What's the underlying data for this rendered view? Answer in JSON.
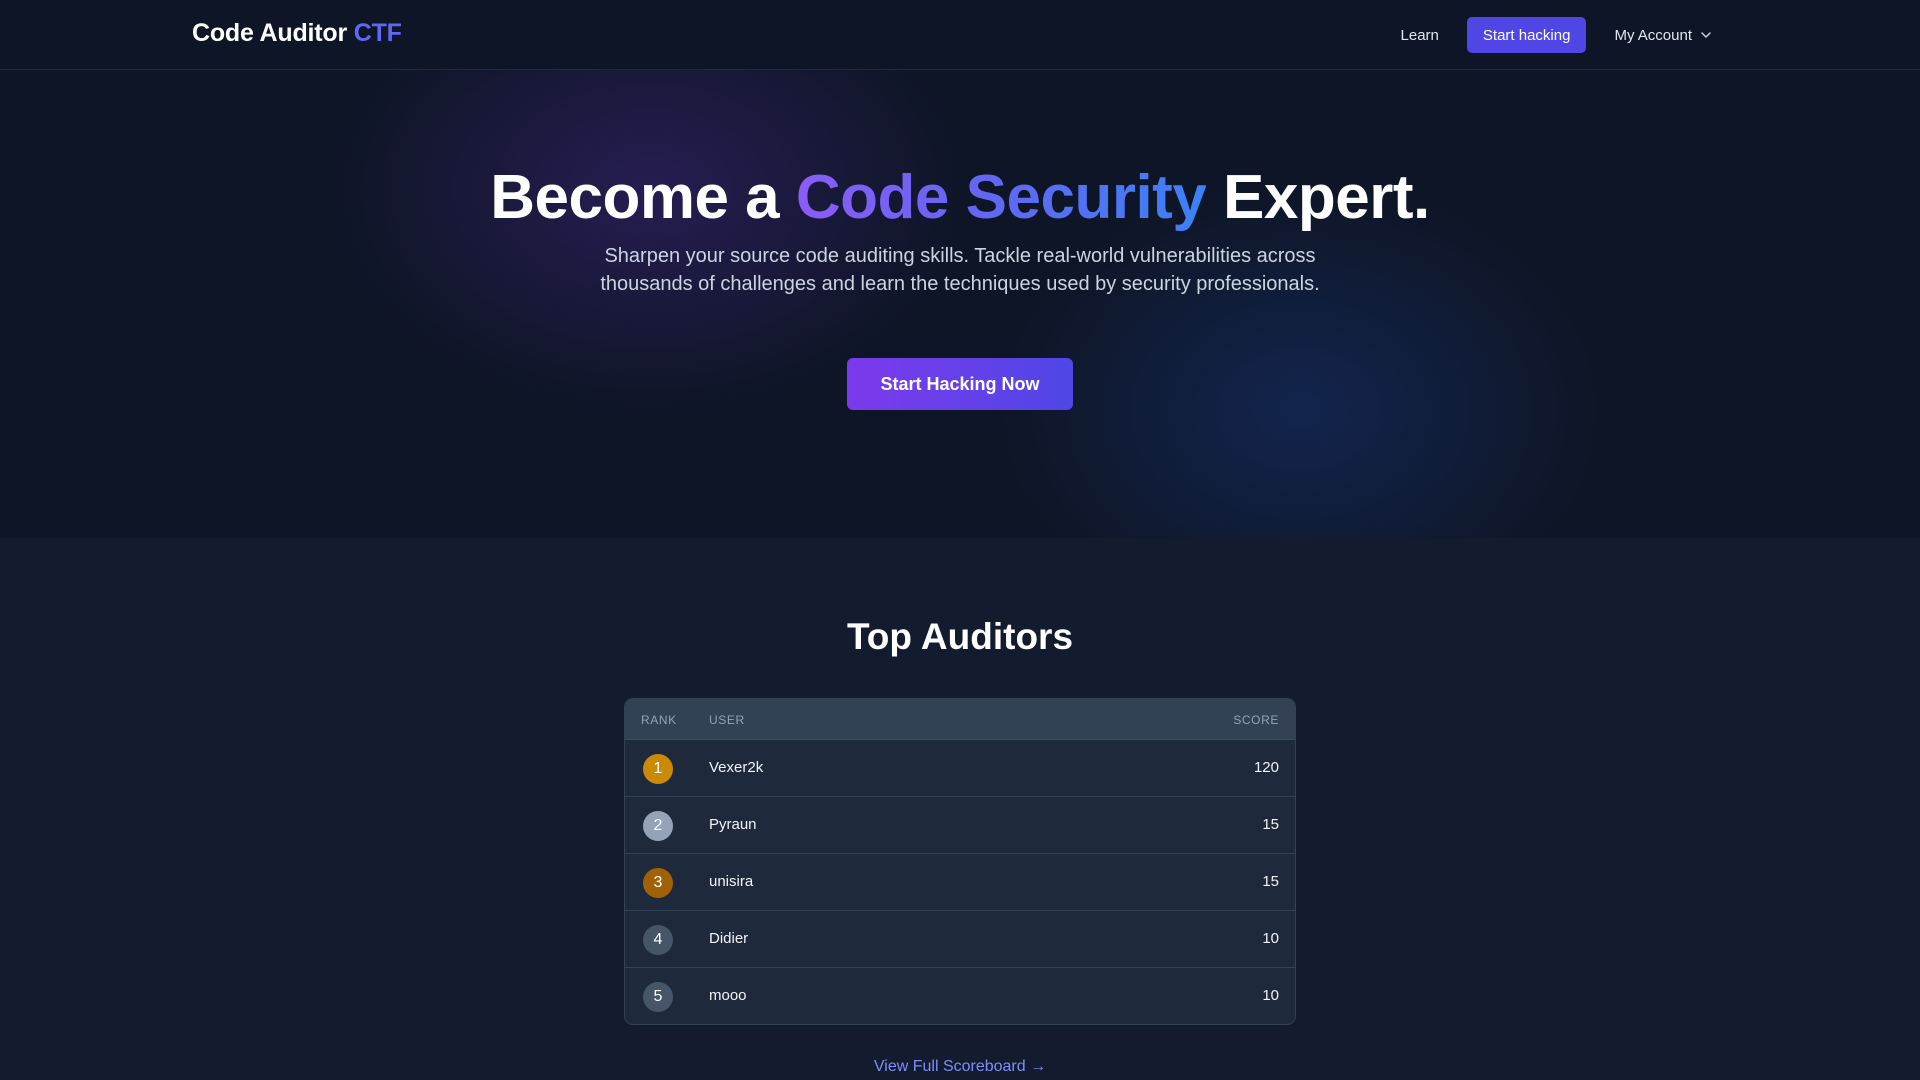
{
  "nav": {
    "logo_main": "Code Auditor",
    "logo_accent": "CTF",
    "learn": "Learn",
    "start_hacking": "Start hacking",
    "account": "My Account",
    "account_icon": "chevron-down-icon"
  },
  "hero": {
    "title_pre": "Become a",
    "title_highlight": "Code Security",
    "title_post": "Expert.",
    "subtitle": "Sharpen your source code auditing skills. Tackle real-world vulnerabilities across thousands of challenges and learn the techniques used by security professionals.",
    "cta": "Start Hacking Now"
  },
  "leaderboard": {
    "title": "Top Auditors",
    "headers": {
      "rank": "RANK",
      "user": "USER",
      "score": "SCORE"
    },
    "rows": [
      {
        "rank": "1",
        "user": "Vexer2k",
        "score": "120",
        "badge_color": "#ca8a04"
      },
      {
        "rank": "2",
        "user": "Pyraun",
        "score": "15",
        "badge_color": "#94a3b8"
      },
      {
        "rank": "3",
        "user": "unisira",
        "score": "15",
        "badge_color": "#a16207"
      },
      {
        "rank": "4",
        "user": "Didier",
        "score": "10",
        "badge_color": "#475569"
      },
      {
        "rank": "5",
        "user": "mooo",
        "score": "10",
        "badge_color": "#475569"
      }
    ],
    "view_all": "View Full Scoreboard →"
  },
  "colors": {
    "accent": "#6366f1",
    "nav_button": "#4f46e5",
    "cta_gradient_start": "#7c3aed",
    "cta_gradient_end": "#4f46e5"
  }
}
